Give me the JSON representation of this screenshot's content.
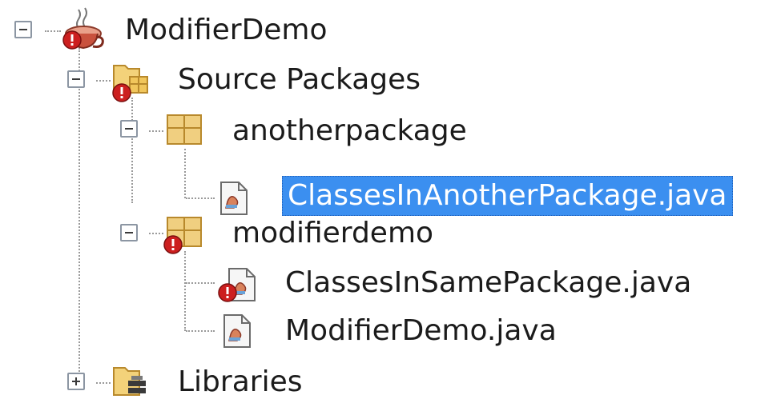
{
  "tree": {
    "project": {
      "label": "ModifierDemo",
      "expanded": true,
      "has_error": true
    },
    "source_packages": {
      "label": "Source Packages",
      "expanded": true,
      "has_error": true
    },
    "anotherpackage": {
      "label": "anotherpackage",
      "expanded": true
    },
    "classes_in_another_package": {
      "label": "ClassesInAnotherPackage.java",
      "selected": true
    },
    "modifierdemo_pkg": {
      "label": "modifierdemo",
      "expanded": true,
      "has_error": true
    },
    "classes_in_same_package": {
      "label": "ClassesInSamePackage.java",
      "has_error": true
    },
    "modifierdemo_java": {
      "label": "ModifierDemo.java"
    },
    "libraries": {
      "label": "Libraries",
      "expanded": false
    }
  },
  "icons": {
    "project": "coffee-cup-icon",
    "source_packages": "source-folder-icon",
    "package": "package-icon",
    "java_file": "java-file-icon",
    "libraries": "library-folder-icon",
    "error_badge": "error-badge-icon"
  },
  "colors": {
    "selection": "#3b8ff0",
    "error": "#cc1f1f",
    "package": "#e8c26a"
  }
}
